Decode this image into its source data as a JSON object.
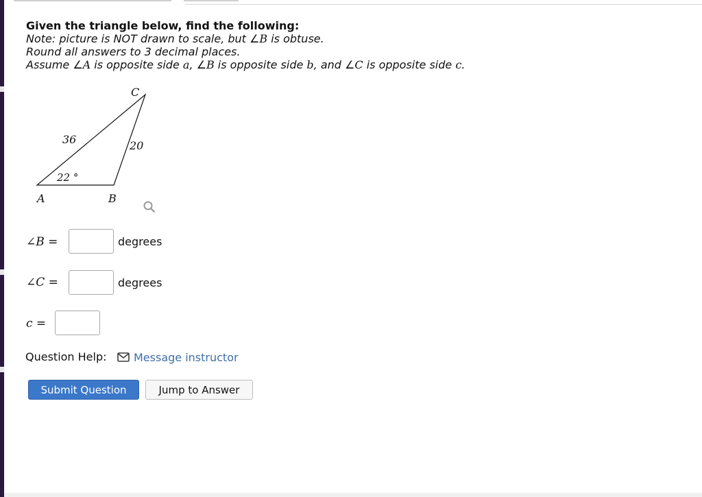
{
  "question": {
    "title": "Given the triangle below, find the following:",
    "note_prefix": "Note: picture is NOT drawn to scale, but ",
    "note_angle": "B",
    "note_suffix": " is obtuse.",
    "round_text": "Round all answers to 3 decimal places.",
    "assume_1": "Assume ",
    "assume_A": "A",
    "assume_2": " is opposite side ",
    "assume_a": "a",
    "assume_3": ", ",
    "assume_B": "B",
    "assume_4": " is opposite side ",
    "assume_b": "b",
    "assume_5": ", and ",
    "assume_C": "C",
    "assume_6": " is opposite side ",
    "assume_c": "c",
    "assume_7": "."
  },
  "figure": {
    "vertex_A": "A",
    "vertex_B": "B",
    "vertex_C": "C",
    "side_AC": "36",
    "side_BC": "20",
    "angle_A": "22 °",
    "zoom_icon": "magnifier-icon"
  },
  "answers": {
    "angle_B": {
      "var": "B",
      "eq": " =",
      "value": "",
      "unit": "degrees"
    },
    "angle_C": {
      "var": "C",
      "eq": " =",
      "value": "",
      "unit": "degrees"
    },
    "side_c": {
      "var": "c",
      "eq": " =",
      "value": ""
    }
  },
  "help": {
    "label": "Question Help:",
    "message_link": "Message instructor",
    "message_icon": "envelope-icon"
  },
  "buttons": {
    "submit": "Submit Question",
    "jump": "Jump to Answer"
  },
  "colors": {
    "submit_bg": "#3b78c9",
    "link": "#3f6fa8"
  }
}
